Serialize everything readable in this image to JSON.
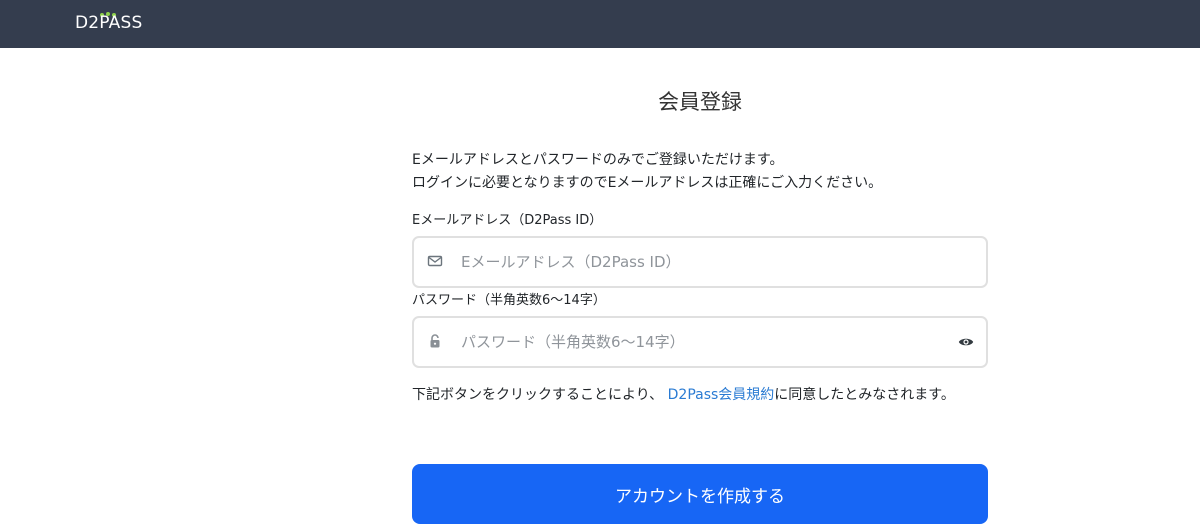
{
  "header": {
    "logo_text": "D2PASS",
    "logo_dot_color": "#8ed14a",
    "background_color": "#343d4e"
  },
  "page": {
    "title": "会員登録",
    "intro_line1": "Eメールアドレスとパスワードのみでご登録いただけます。",
    "intro_line2": "ログインに必要となりますのでEメールアドレスは正確にご入力ください。"
  },
  "form": {
    "email": {
      "label": "Eメールアドレス（D2Pass ID）",
      "placeholder": "Eメールアドレス（D2Pass ID）",
      "value": "",
      "icon": "envelope-icon"
    },
    "password": {
      "label": "パスワード（半角英数6〜14字）",
      "placeholder": "パスワード（半角英数6〜14字）",
      "value": "",
      "icon": "lock-icon",
      "toggle_icon": "eye-icon"
    },
    "agreement": {
      "before_link": "下記ボタンをクリックすることにより、",
      "link_text": "D2Pass会員規約",
      "after_link": "に同意したとみなされます。"
    },
    "submit_label": "アカウントを作成する",
    "submit_color": "#1766f5"
  }
}
